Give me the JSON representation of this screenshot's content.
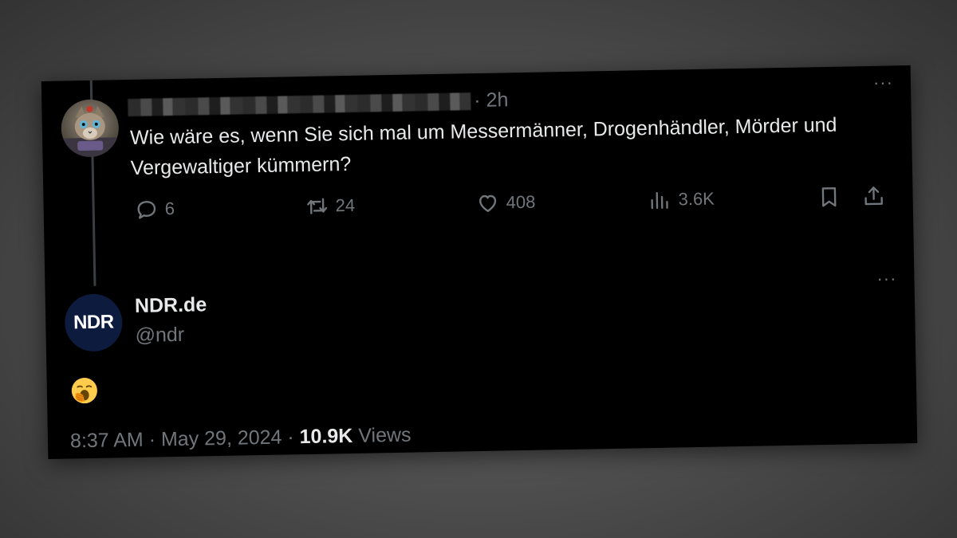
{
  "tweet": {
    "author_name_redacted": true,
    "time_ago": "· 2h",
    "text": "Wie wäre es, wenn Sie sich mal um Messermänner, Drogenhändler, Mörder und Vergewaltiger kümmern?",
    "more_label": "···",
    "actions": {
      "reply_count": "6",
      "retweet_count": "24",
      "like_count": "408",
      "views_count": "3.6K"
    },
    "icons": {
      "reply": "reply-icon",
      "retweet": "retweet-icon",
      "like": "heart-icon",
      "views": "views-icon",
      "bookmark": "bookmark-icon",
      "share": "share-icon"
    }
  },
  "reply": {
    "avatar_text": "NDR",
    "display_name": "NDR.de",
    "handle": "@ndr",
    "more_label": "···",
    "emoji": "yawning-face-emoji",
    "time": "8:37 AM · May 29, 2024 ·",
    "views_count": "10.9K",
    "views_label": "Views"
  },
  "colors": {
    "background": "#000000",
    "text_primary": "#e7e9ea",
    "text_secondary": "#71767b",
    "ndr_avatar": "#0d1b3e"
  }
}
